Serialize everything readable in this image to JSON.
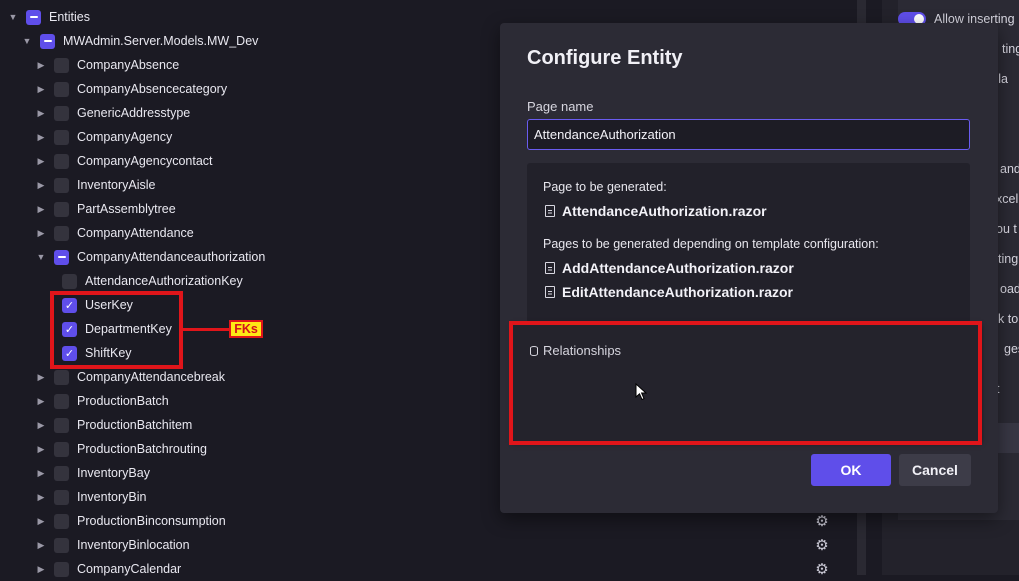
{
  "tree": {
    "root": "Entities",
    "namespace": "MWAdmin.Server.Models.MW_Dev",
    "entities_before": [
      "CompanyAbsence",
      "CompanyAbsencecategory",
      "GenericAddresstype",
      "CompanyAgency",
      "CompanyAgencycontact",
      "InventoryAisle",
      "PartAssemblytree",
      "CompanyAttendance"
    ],
    "expanded_entity": "CompanyAttendanceauthorization",
    "fields": [
      {
        "name": "AttendanceAuthorizationKey",
        "checked": false
      },
      {
        "name": "UserKey",
        "checked": true
      },
      {
        "name": "DepartmentKey",
        "checked": true
      },
      {
        "name": "ShiftKey",
        "checked": true
      }
    ],
    "entities_after": [
      "CompanyAttendancebreak",
      "ProductionBatch",
      "ProductionBatchitem",
      "ProductionBatchrouting",
      "InventoryBay",
      "InventoryBin",
      "ProductionBinconsumption",
      "InventoryBinlocation",
      "CompanyCalendar"
    ],
    "fk_annotation": "FKs"
  },
  "side_panel": {
    "items": [
      "Allow inserting",
      "ting",
      "cla",
      "and",
      "xcel",
      "ou t",
      "ting",
      "oad",
      "k to",
      "ges",
      "t"
    ]
  },
  "dialog": {
    "title": "Configure Entity",
    "page_name_label": "Page name",
    "page_name_value": "AttendanceAuthorization",
    "generated_label": "Page to be generated:",
    "generated_file": "AttendanceAuthorization.razor",
    "conditional_label": "Pages to be generated depending on template configuration:",
    "conditional_files": [
      "AddAttendanceAuthorization.razor",
      "EditAttendanceAuthorization.razor"
    ],
    "relationships_label": "Relationships",
    "ok_label": "OK",
    "cancel_label": "Cancel"
  },
  "colors": {
    "background": "#1b1a23",
    "accent": "#5f4eea",
    "highlight_red": "#e0151a",
    "tag_yellow": "#ffe815"
  }
}
